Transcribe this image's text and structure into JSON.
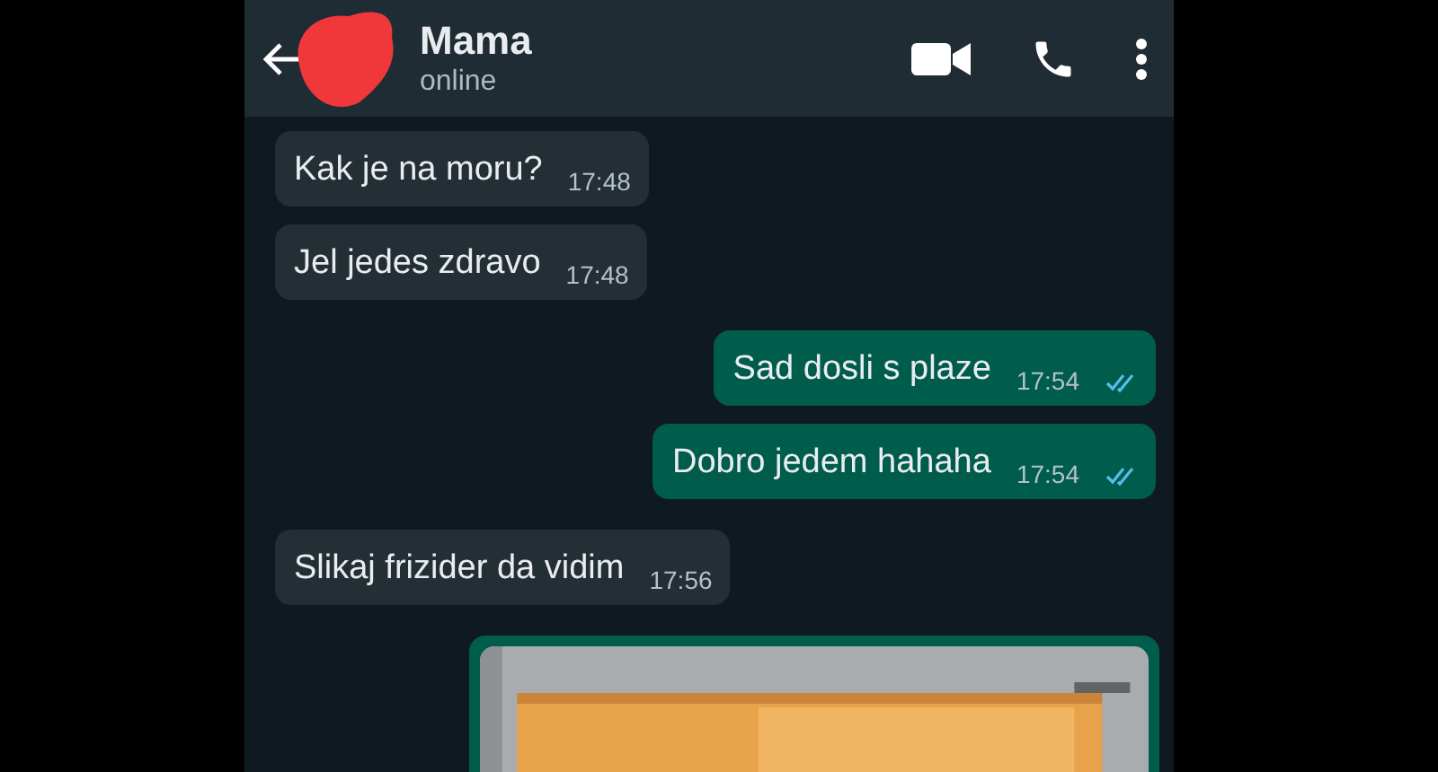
{
  "header": {
    "contact_name": "Mama",
    "status": "online"
  },
  "messages": [
    {
      "kind": "text",
      "sent": false,
      "text": "Kak je na moru?",
      "time": "17:48"
    },
    {
      "kind": "text",
      "sent": false,
      "text": "Jel jedes zdravo",
      "time": "17:48"
    },
    {
      "kind": "text",
      "sent": true,
      "text": "Sad dosli s plaze",
      "time": "17:54",
      "read": true
    },
    {
      "kind": "text",
      "sent": true,
      "text": "Dobro jedem hahaha",
      "time": "17:54",
      "read": true
    },
    {
      "kind": "text",
      "sent": false,
      "text": "Slikaj frizider da vidim",
      "time": "17:56"
    },
    {
      "kind": "picture",
      "sent": true
    }
  ]
}
